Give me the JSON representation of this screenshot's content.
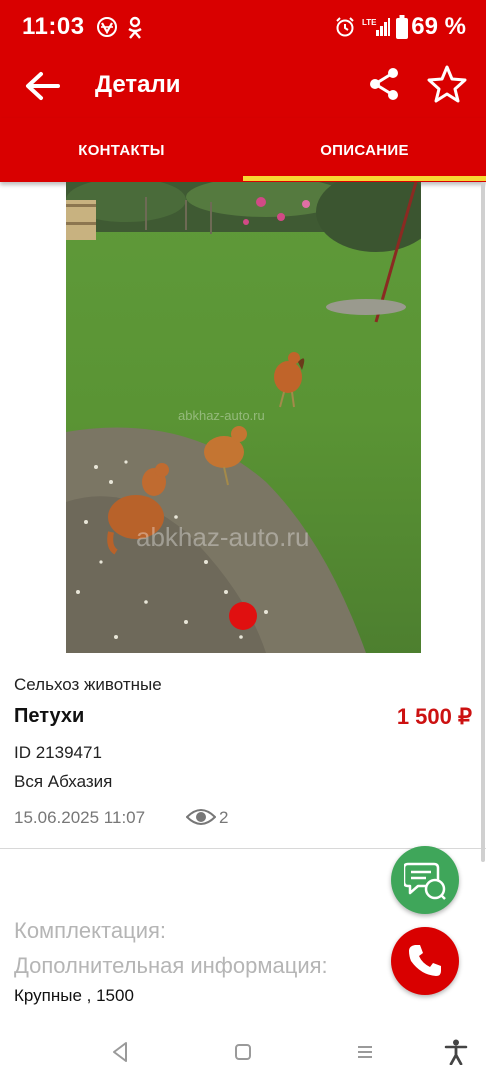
{
  "status_bar": {
    "time": "11:03",
    "battery_percent": "69 %",
    "icons": [
      "vpn-icon",
      "odnoklassniki-icon",
      "alarm-icon",
      "lte-signal-icon",
      "battery-icon"
    ]
  },
  "app_bar": {
    "title": "Детали",
    "icons": [
      "arrow-back-icon",
      "share-icon",
      "star-outline-icon"
    ]
  },
  "tabs": {
    "items": [
      {
        "label": "КОНТАКТЫ",
        "selected": false
      },
      {
        "label": "ОПИСАНИЕ",
        "selected": true
      }
    ]
  },
  "photo": {
    "watermark_1": "abkhaz-auto.ru",
    "watermark_2": "abkhaz-auto.ru",
    "page_index": 1,
    "page_count": 1
  },
  "listing": {
    "category": "Сельхоз животные",
    "title": "Петухи",
    "price": "1 500 ₽",
    "id_text": "ID 2139471",
    "region": "Вся Абхазия",
    "date": "15.06.2025 11:07",
    "views": "2"
  },
  "description": {
    "equipment_label": "Комплектация:",
    "additional_label": "Дополнительная информация:",
    "text": "Крупные , 1500"
  },
  "colors": {
    "brand_red": "#d90000",
    "tab_indicator": "#f7d733",
    "price_red": "#cc1111",
    "chat_green": "#3fa65a"
  },
  "nav_bar": {
    "icons": [
      "nav-back-icon",
      "nav-home-icon",
      "nav-recents-icon",
      "accessibility-icon"
    ]
  }
}
